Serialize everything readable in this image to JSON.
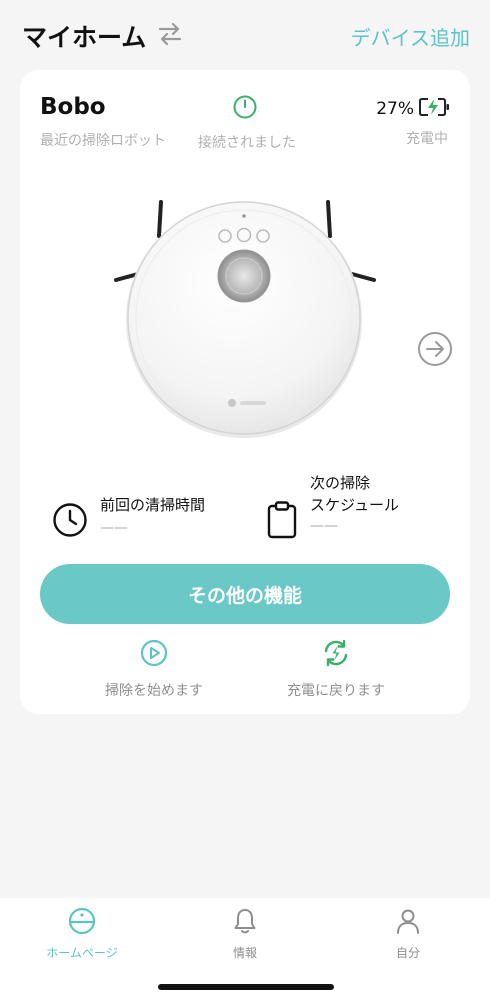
{
  "header": {
    "title": "マイホーム",
    "switch_icon": "swap-arrows-icon",
    "add_device_label": "デバイス追加"
  },
  "device": {
    "name": "Bobo",
    "subtitle": "最近の掃除ロボット",
    "connection_icon": "power-icon",
    "connection_status": "接続されました",
    "battery_percent": "27%",
    "battery_icon": "battery-charging-icon",
    "charge_status": "充電中",
    "next_icon": "arrow-right-circle-icon"
  },
  "info": {
    "last_clean_label": "前回の清掃時間",
    "last_clean_value": "——",
    "last_clean_icon": "clock-icon",
    "next_schedule_label_line1": "次の掃除",
    "next_schedule_label_line2": "スケジュール",
    "next_schedule_value": "——",
    "next_schedule_icon": "clipboard-icon"
  },
  "more_button_label": "その他の機能",
  "actions": {
    "start_label": "掃除を始めます",
    "start_icon": "play-circle-icon",
    "dock_label": "充電に戻ります",
    "dock_icon": "recharge-icon"
  },
  "nav": {
    "home_label": "ホームページ",
    "info_label": "情報",
    "me_label": "自分"
  },
  "colors": {
    "accent": "#5cc4c4",
    "button": "#6ac8c6",
    "success": "#3cb06a",
    "background": "#f5f5f5"
  }
}
